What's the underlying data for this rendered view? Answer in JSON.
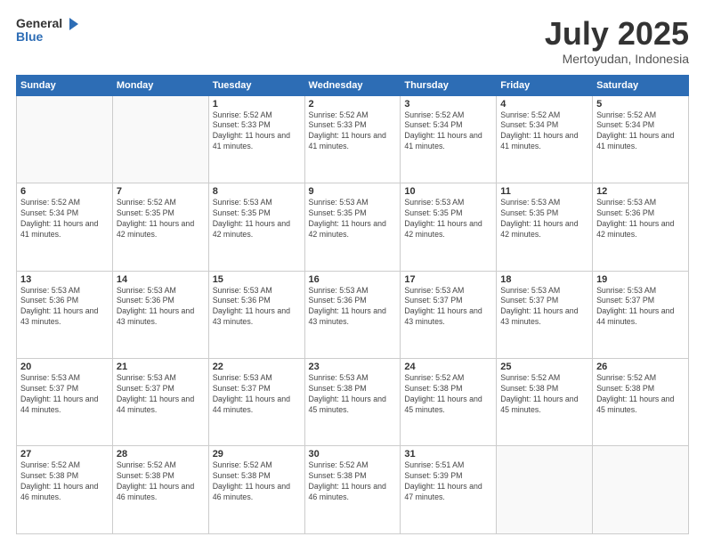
{
  "header": {
    "logo_general": "General",
    "logo_blue": "Blue",
    "month": "July 2025",
    "location": "Mertoyudan, Indonesia"
  },
  "weekdays": [
    "Sunday",
    "Monday",
    "Tuesday",
    "Wednesday",
    "Thursday",
    "Friday",
    "Saturday"
  ],
  "weeks": [
    [
      {
        "day": "",
        "info": ""
      },
      {
        "day": "",
        "info": ""
      },
      {
        "day": "1",
        "info": "Sunrise: 5:52 AM\nSunset: 5:33 PM\nDaylight: 11 hours\nand 41 minutes."
      },
      {
        "day": "2",
        "info": "Sunrise: 5:52 AM\nSunset: 5:33 PM\nDaylight: 11 hours\nand 41 minutes."
      },
      {
        "day": "3",
        "info": "Sunrise: 5:52 AM\nSunset: 5:34 PM\nDaylight: 11 hours\nand 41 minutes."
      },
      {
        "day": "4",
        "info": "Sunrise: 5:52 AM\nSunset: 5:34 PM\nDaylight: 11 hours\nand 41 minutes."
      },
      {
        "day": "5",
        "info": "Sunrise: 5:52 AM\nSunset: 5:34 PM\nDaylight: 11 hours\nand 41 minutes."
      }
    ],
    [
      {
        "day": "6",
        "info": "Sunrise: 5:52 AM\nSunset: 5:34 PM\nDaylight: 11 hours\nand 41 minutes."
      },
      {
        "day": "7",
        "info": "Sunrise: 5:52 AM\nSunset: 5:35 PM\nDaylight: 11 hours\nand 42 minutes."
      },
      {
        "day": "8",
        "info": "Sunrise: 5:53 AM\nSunset: 5:35 PM\nDaylight: 11 hours\nand 42 minutes."
      },
      {
        "day": "9",
        "info": "Sunrise: 5:53 AM\nSunset: 5:35 PM\nDaylight: 11 hours\nand 42 minutes."
      },
      {
        "day": "10",
        "info": "Sunrise: 5:53 AM\nSunset: 5:35 PM\nDaylight: 11 hours\nand 42 minutes."
      },
      {
        "day": "11",
        "info": "Sunrise: 5:53 AM\nSunset: 5:35 PM\nDaylight: 11 hours\nand 42 minutes."
      },
      {
        "day": "12",
        "info": "Sunrise: 5:53 AM\nSunset: 5:36 PM\nDaylight: 11 hours\nand 42 minutes."
      }
    ],
    [
      {
        "day": "13",
        "info": "Sunrise: 5:53 AM\nSunset: 5:36 PM\nDaylight: 11 hours\nand 43 minutes."
      },
      {
        "day": "14",
        "info": "Sunrise: 5:53 AM\nSunset: 5:36 PM\nDaylight: 11 hours\nand 43 minutes."
      },
      {
        "day": "15",
        "info": "Sunrise: 5:53 AM\nSunset: 5:36 PM\nDaylight: 11 hours\nand 43 minutes."
      },
      {
        "day": "16",
        "info": "Sunrise: 5:53 AM\nSunset: 5:36 PM\nDaylight: 11 hours\nand 43 minutes."
      },
      {
        "day": "17",
        "info": "Sunrise: 5:53 AM\nSunset: 5:37 PM\nDaylight: 11 hours\nand 43 minutes."
      },
      {
        "day": "18",
        "info": "Sunrise: 5:53 AM\nSunset: 5:37 PM\nDaylight: 11 hours\nand 43 minutes."
      },
      {
        "day": "19",
        "info": "Sunrise: 5:53 AM\nSunset: 5:37 PM\nDaylight: 11 hours\nand 44 minutes."
      }
    ],
    [
      {
        "day": "20",
        "info": "Sunrise: 5:53 AM\nSunset: 5:37 PM\nDaylight: 11 hours\nand 44 minutes."
      },
      {
        "day": "21",
        "info": "Sunrise: 5:53 AM\nSunset: 5:37 PM\nDaylight: 11 hours\nand 44 minutes."
      },
      {
        "day": "22",
        "info": "Sunrise: 5:53 AM\nSunset: 5:37 PM\nDaylight: 11 hours\nand 44 minutes."
      },
      {
        "day": "23",
        "info": "Sunrise: 5:53 AM\nSunset: 5:38 PM\nDaylight: 11 hours\nand 45 minutes."
      },
      {
        "day": "24",
        "info": "Sunrise: 5:52 AM\nSunset: 5:38 PM\nDaylight: 11 hours\nand 45 minutes."
      },
      {
        "day": "25",
        "info": "Sunrise: 5:52 AM\nSunset: 5:38 PM\nDaylight: 11 hours\nand 45 minutes."
      },
      {
        "day": "26",
        "info": "Sunrise: 5:52 AM\nSunset: 5:38 PM\nDaylight: 11 hours\nand 45 minutes."
      }
    ],
    [
      {
        "day": "27",
        "info": "Sunrise: 5:52 AM\nSunset: 5:38 PM\nDaylight: 11 hours\nand 46 minutes."
      },
      {
        "day": "28",
        "info": "Sunrise: 5:52 AM\nSunset: 5:38 PM\nDaylight: 11 hours\nand 46 minutes."
      },
      {
        "day": "29",
        "info": "Sunrise: 5:52 AM\nSunset: 5:38 PM\nDaylight: 11 hours\nand 46 minutes."
      },
      {
        "day": "30",
        "info": "Sunrise: 5:52 AM\nSunset: 5:38 PM\nDaylight: 11 hours\nand 46 minutes."
      },
      {
        "day": "31",
        "info": "Sunrise: 5:51 AM\nSunset: 5:39 PM\nDaylight: 11 hours\nand 47 minutes."
      },
      {
        "day": "",
        "info": ""
      },
      {
        "day": "",
        "info": ""
      }
    ]
  ]
}
